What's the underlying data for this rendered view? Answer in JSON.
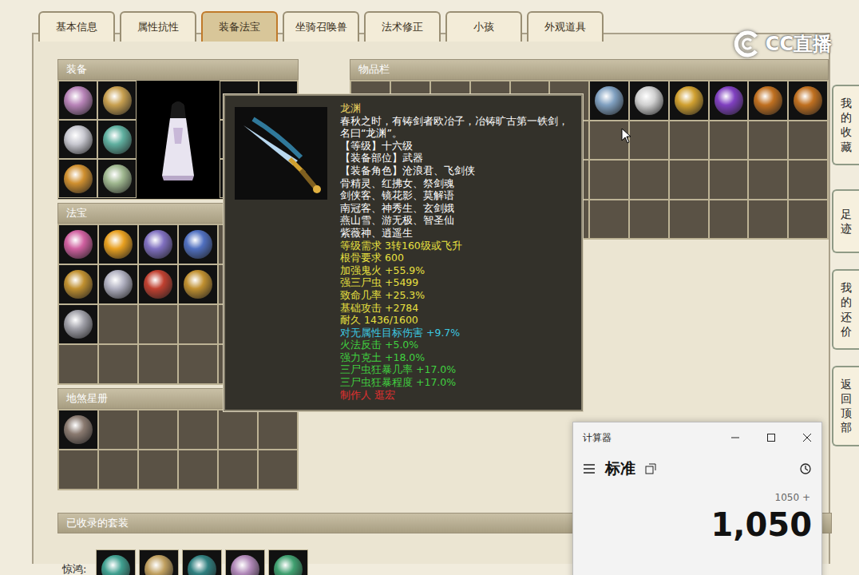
{
  "tabs": [
    {
      "label": "基本信息",
      "selected": false
    },
    {
      "label": "属性抗性",
      "selected": false
    },
    {
      "label": "装备法宝",
      "selected": true
    },
    {
      "label": "坐骑召唤兽",
      "selected": false
    },
    {
      "label": "法术修正",
      "selected": false
    },
    {
      "label": "小孩",
      "selected": false
    },
    {
      "label": "外观道具",
      "selected": false
    }
  ],
  "logo": "CC直播",
  "equipment": {
    "title": "装备",
    "left_slots": [
      {
        "filled": true,
        "color": "#b884b8"
      },
      {
        "filled": true,
        "color": "#c8a050"
      },
      {
        "filled": true,
        "color": "#c8c8d0"
      },
      {
        "filled": true,
        "color": "#60b0a0"
      },
      {
        "filled": true,
        "color": "#d09030"
      },
      {
        "filled": true,
        "color": "#a0b890"
      }
    ],
    "right_slots": [
      {
        "filled": false
      },
      {
        "filled": false
      },
      {
        "filled": false
      },
      {
        "filled": false
      },
      {
        "filled": false
      },
      {
        "filled": false
      }
    ]
  },
  "fabao": {
    "title": "法宝",
    "slots": [
      {
        "filled": true,
        "color": "#d060a0"
      },
      {
        "filled": true,
        "color": "#e8a020"
      },
      {
        "filled": true,
        "color": "#8070c0"
      },
      {
        "filled": true,
        "color": "#5070c0"
      },
      {
        "filled": false
      },
      {
        "filled": false
      },
      {
        "filled": true,
        "color": "#c09030"
      },
      {
        "filled": true,
        "color": "#b0b0c0"
      },
      {
        "filled": true,
        "color": "#c04030"
      },
      {
        "filled": true,
        "color": "#c09030"
      },
      {
        "filled": false
      },
      {
        "filled": false
      },
      {
        "filled": true,
        "color": "#a0a0a8"
      },
      {
        "filled": false
      },
      {
        "filled": false
      },
      {
        "filled": false
      },
      {
        "filled": false
      },
      {
        "filled": false
      },
      {
        "filled": false
      },
      {
        "filled": false
      },
      {
        "filled": false
      },
      {
        "filled": false
      },
      {
        "filled": false
      },
      {
        "filled": false
      }
    ]
  },
  "disha": {
    "title": "地煞星册",
    "slots": [
      {
        "filled": true,
        "color": "#8a7a70"
      },
      {
        "filled": false
      },
      {
        "filled": false
      },
      {
        "filled": false
      },
      {
        "filled": false
      },
      {
        "filled": false
      },
      {
        "filled": false
      },
      {
        "filled": false
      },
      {
        "filled": false
      },
      {
        "filled": false
      },
      {
        "filled": false
      },
      {
        "filled": false
      }
    ]
  },
  "inventory": {
    "title": "物品栏",
    "slots": [
      {
        "filled": false
      },
      {
        "filled": false
      },
      {
        "filled": false
      },
      {
        "filled": false
      },
      {
        "filled": false
      },
      {
        "filled": false
      },
      {
        "filled": true,
        "color": "#80a0c0"
      },
      {
        "filled": true,
        "color": "#d0d0d0"
      },
      {
        "filled": true,
        "color": "#d0a030"
      },
      {
        "filled": true,
        "color": "#8040c0"
      },
      {
        "filled": true,
        "color": "#c07020"
      },
      {
        "filled": true,
        "color": "#c07020"
      },
      {
        "filled": false
      },
      {
        "filled": false
      },
      {
        "filled": false
      },
      {
        "filled": false
      },
      {
        "filled": false
      },
      {
        "filled": false
      },
      {
        "filled": false
      },
      {
        "filled": false
      },
      {
        "filled": false
      },
      {
        "filled": false
      },
      {
        "filled": false
      },
      {
        "filled": false
      },
      {
        "filled": false
      },
      {
        "filled": false
      },
      {
        "filled": false
      },
      {
        "filled": false
      },
      {
        "filled": false
      },
      {
        "filled": false
      },
      {
        "filled": false
      },
      {
        "filled": false
      },
      {
        "filled": false
      },
      {
        "filled": false
      },
      {
        "filled": false
      },
      {
        "filled": false
      },
      {
        "filled": false
      },
      {
        "filled": false
      },
      {
        "filled": false
      },
      {
        "filled": false
      },
      {
        "filled": false
      },
      {
        "filled": false
      },
      {
        "filled": false
      },
      {
        "filled": false
      },
      {
        "filled": false
      },
      {
        "filled": false
      },
      {
        "filled": false
      },
      {
        "filled": false
      }
    ]
  },
  "tooltip": {
    "title": "龙渊",
    "lines": [
      {
        "text": "春秋之时，有铸剑者欧冶子，冶铸旷古第一铁剑，",
        "color": "#ffffff"
      },
      {
        "text": "名曰“龙渊”。",
        "color": "#ffffff"
      },
      {
        "text": "【等级】十六级",
        "color": "#ffffff"
      },
      {
        "text": "【装备部位】武器",
        "color": "#ffffff"
      },
      {
        "text": "【装备角色】沧浪君、飞剑侠",
        "color": "#ffffff"
      },
      {
        "text": "骨精灵、红拂女、祭剑魂",
        "color": "#ffffff"
      },
      {
        "text": "剑侠客、镜花影、莫解语",
        "color": "#ffffff"
      },
      {
        "text": "南冠客、神秀生、玄剑娥",
        "color": "#ffffff"
      },
      {
        "text": "燕山雪、游无极、智圣仙",
        "color": "#ffffff"
      },
      {
        "text": "紫薇神、逍遥生",
        "color": "#ffffff"
      },
      {
        "text": "等级需求 3转160级或飞升",
        "color": "#e8e040"
      },
      {
        "text": "根骨要求 600",
        "color": "#e8e040"
      },
      {
        "text": "加强鬼火 +55.9%",
        "color": "#e8e040"
      },
      {
        "text": "强三尸虫 +5499",
        "color": "#e8e040"
      },
      {
        "text": "致命几率 +25.3%",
        "color": "#e8e040"
      },
      {
        "text": "基础攻击 +2784",
        "color": "#e8e040"
      },
      {
        "text": "耐久 1436/1600",
        "color": "#e8e040"
      },
      {
        "text": "对无属性目标伤害 +9.7%",
        "color": "#3cc8e0"
      },
      {
        "text": "火法反击 +5.0%",
        "color": "#40d040"
      },
      {
        "text": "强力克土 +18.0%",
        "color": "#40d040"
      },
      {
        "text": "三尸虫狂暴几率 +17.0%",
        "color": "#40d040"
      },
      {
        "text": "三尸虫狂暴程度 +17.0%",
        "color": "#40d040"
      },
      {
        "text": "制作人 逛宏",
        "color": "#e03030"
      }
    ]
  },
  "sidebar": [
    "我的收藏",
    "足迹",
    "我的还价",
    "返回顶部"
  ],
  "suits": {
    "title": "已收录的套装",
    "rows": [
      {
        "label": "惊鸿:",
        "items": [
          {
            "color": "#40a090"
          },
          {
            "color": "#c0a060"
          },
          {
            "color": "#308080"
          },
          {
            "color": "#b088b8"
          },
          {
            "color": "#40a070"
          }
        ]
      }
    ]
  },
  "calculator": {
    "title": "计算器",
    "mode": "标准",
    "history": "1050 +",
    "display": "1,050"
  }
}
